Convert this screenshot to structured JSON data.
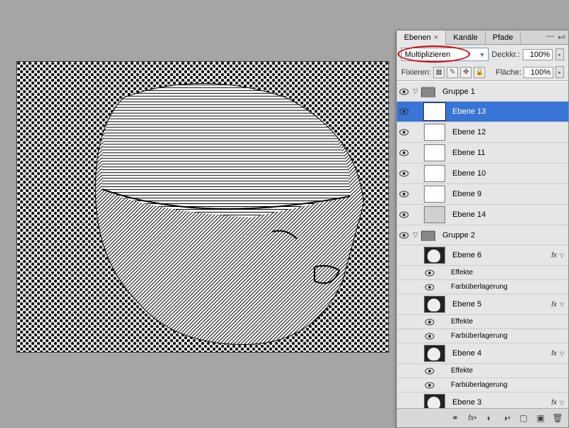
{
  "tabs": {
    "layers": "Ebenen",
    "channels": "Kanäle",
    "paths": "Pfade"
  },
  "blend": {
    "mode": "Multiplizieren",
    "opacity_label": "Deckkr.:",
    "opacity": "100%",
    "fill_label": "Fläche:",
    "fill": "100%",
    "lock_label": "Fixieren:"
  },
  "groups": [
    {
      "name": "Gruppe 1",
      "layers": [
        {
          "name": "Ebene 13",
          "thumb": "white",
          "sel": true
        },
        {
          "name": "Ebene 12",
          "thumb": "white"
        },
        {
          "name": "Ebene 11",
          "thumb": "white"
        },
        {
          "name": "Ebene 10",
          "thumb": "white"
        },
        {
          "name": "Ebene 9",
          "thumb": "white"
        },
        {
          "name": "Ebene 14",
          "thumb": "gray"
        }
      ]
    },
    {
      "name": "Gruppe 2",
      "layers": [
        {
          "name": "Ebene 6",
          "thumb": "sil",
          "fx": true,
          "effects": [
            "Effekte",
            "Farbüberlagerung"
          ]
        },
        {
          "name": "Ebene 5",
          "thumb": "sil",
          "fx": true,
          "effects": [
            "Effekte",
            "Farbüberlagerung"
          ]
        },
        {
          "name": "Ebene 4",
          "thumb": "sil",
          "fx": true,
          "effects": [
            "Effekte",
            "Farbüberlagerung"
          ]
        },
        {
          "name": "Ebene 3",
          "thumb": "sil",
          "fx": true,
          "effects": []
        }
      ]
    }
  ],
  "fx_label": "fx",
  "effects_label": "Effekte",
  "color_overlay_label": "Farbüberlagerung"
}
